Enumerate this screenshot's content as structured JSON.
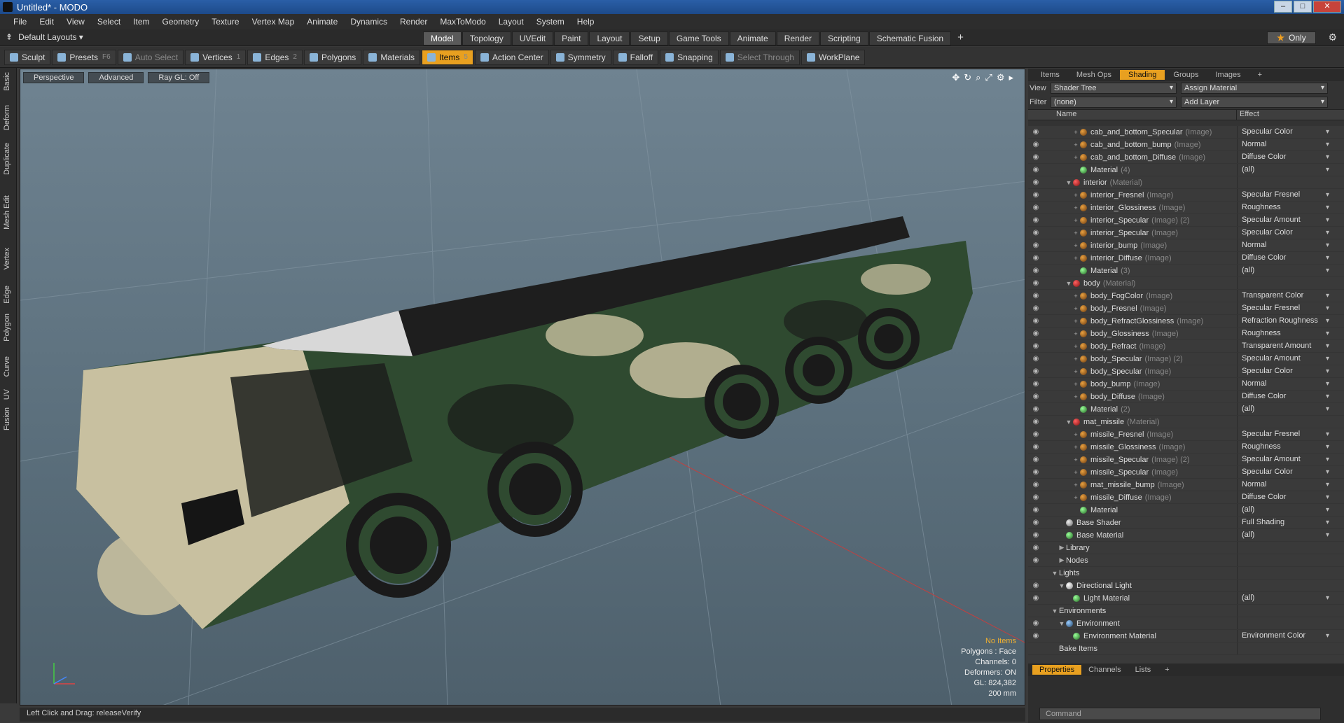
{
  "window": {
    "title": "Untitled* - MODO"
  },
  "menu": [
    "File",
    "Edit",
    "View",
    "Select",
    "Item",
    "Geometry",
    "Texture",
    "Vertex Map",
    "Animate",
    "Dynamics",
    "Render",
    "MaxToModo",
    "Layout",
    "System",
    "Help"
  ],
  "layout": {
    "name": "Default Layouts",
    "tabs": [
      "Model",
      "Topology",
      "UVEdit",
      "Paint",
      "Layout",
      "Setup",
      "Game Tools",
      "Animate",
      "Render",
      "Scripting",
      "Schematic Fusion"
    ],
    "active_tab": "Model",
    "only_label": "Only"
  },
  "toolbar": [
    {
      "label": "Sculpt",
      "key": ""
    },
    {
      "label": "Presets",
      "key": "F6"
    },
    {
      "label": "Auto Select",
      "key": "",
      "dim": true
    },
    {
      "label": "Vertices",
      "key": "1"
    },
    {
      "label": "Edges",
      "key": "2"
    },
    {
      "label": "Polygons",
      "key": ""
    },
    {
      "label": "Materials",
      "key": ""
    },
    {
      "label": "Items",
      "key": "5",
      "active": true
    },
    {
      "label": "Action Center",
      "key": ""
    },
    {
      "label": "Symmetry",
      "key": ""
    },
    {
      "label": "Falloff",
      "key": ""
    },
    {
      "label": "Snapping",
      "key": ""
    },
    {
      "label": "Select Through",
      "key": "",
      "dim": true
    },
    {
      "label": "WorkPlane",
      "key": ""
    }
  ],
  "leftbar": [
    "Basic",
    "Deform",
    "Duplicate",
    "Mesh Edit",
    "Vertex",
    "Edge",
    "Polygon",
    "Curve",
    "UV",
    "Fusion"
  ],
  "viewport": {
    "buttons": [
      "Perspective",
      "Advanced",
      "Ray GL: Off"
    ],
    "stats": {
      "no_items": "No Items",
      "polygons": "Polygons : Face",
      "channels": "Channels: 0",
      "deformers": "Deformers: ON",
      "gl": "GL: 824,382",
      "scale": "200 mm"
    }
  },
  "status": {
    "text": "Left Click and Drag:  releaseVerify"
  },
  "panel": {
    "tabs": [
      "Items",
      "Mesh Ops",
      "Shading",
      "Groups",
      "Images"
    ],
    "active_tab": "Shading",
    "view_label": "View",
    "view_value": "Shader Tree",
    "assign": "Assign Material",
    "filter_label": "Filter",
    "filter_value": "(none)",
    "add_layer": "Add Layer",
    "col_name": "Name",
    "col_effect": "Effect",
    "tree": [
      {
        "indent": 3,
        "tw": "+",
        "icon": "img",
        "name": "cab_and_bottom_Specular",
        "type": "(Image)",
        "effect": "Specular Color"
      },
      {
        "indent": 3,
        "tw": "+",
        "icon": "img",
        "name": "cab_and_bottom_bump",
        "type": "(Image)",
        "effect": "Normal"
      },
      {
        "indent": 3,
        "tw": "+",
        "icon": "img",
        "name": "cab_and_bottom_Diffuse",
        "type": "(Image)",
        "effect": "Diffuse Color"
      },
      {
        "indent": 3,
        "tw": "",
        "icon": "gr",
        "name": "Material",
        "type": "(4)",
        "effect": "(all)"
      },
      {
        "indent": 2,
        "tw": "▼",
        "icon": "matr",
        "name": "interior",
        "type": "(Material)",
        "effect": ""
      },
      {
        "indent": 3,
        "tw": "+",
        "icon": "img",
        "name": "interior_Fresnel",
        "type": "(Image)",
        "effect": "Specular Fresnel"
      },
      {
        "indent": 3,
        "tw": "+",
        "icon": "img",
        "name": "interior_Glossiness",
        "type": "(Image)",
        "effect": "Roughness"
      },
      {
        "indent": 3,
        "tw": "+",
        "icon": "img",
        "name": "interior_Specular",
        "type": "(Image) (2)",
        "effect": "Specular Amount"
      },
      {
        "indent": 3,
        "tw": "+",
        "icon": "img",
        "name": "interior_Specular",
        "type": "(Image)",
        "effect": "Specular Color"
      },
      {
        "indent": 3,
        "tw": "+",
        "icon": "img",
        "name": "interior_bump",
        "type": "(Image)",
        "effect": "Normal"
      },
      {
        "indent": 3,
        "tw": "+",
        "icon": "img",
        "name": "interior_Diffuse",
        "type": "(Image)",
        "effect": "Diffuse Color"
      },
      {
        "indent": 3,
        "tw": "",
        "icon": "gr",
        "name": "Material",
        "type": "(3)",
        "effect": "(all)"
      },
      {
        "indent": 2,
        "tw": "▼",
        "icon": "matr",
        "name": "body",
        "type": "(Material)",
        "effect": ""
      },
      {
        "indent": 3,
        "tw": "+",
        "icon": "img",
        "name": "body_FogColor",
        "type": "(Image)",
        "effect": "Transparent Color"
      },
      {
        "indent": 3,
        "tw": "+",
        "icon": "img",
        "name": "body_Fresnel",
        "type": "(Image)",
        "effect": "Specular Fresnel"
      },
      {
        "indent": 3,
        "tw": "+",
        "icon": "img",
        "name": "body_RefractGlossiness",
        "type": "(Image)",
        "effect": "Refraction Roughness"
      },
      {
        "indent": 3,
        "tw": "+",
        "icon": "img",
        "name": "body_Glossiness",
        "type": "(Image)",
        "effect": "Roughness"
      },
      {
        "indent": 3,
        "tw": "+",
        "icon": "img",
        "name": "body_Refract",
        "type": "(Image)",
        "effect": "Transparent Amount"
      },
      {
        "indent": 3,
        "tw": "+",
        "icon": "img",
        "name": "body_Specular",
        "type": "(Image) (2)",
        "effect": "Specular Amount"
      },
      {
        "indent": 3,
        "tw": "+",
        "icon": "img",
        "name": "body_Specular",
        "type": "(Image)",
        "effect": "Specular Color"
      },
      {
        "indent": 3,
        "tw": "+",
        "icon": "img",
        "name": "body_bump",
        "type": "(Image)",
        "effect": "Normal"
      },
      {
        "indent": 3,
        "tw": "+",
        "icon": "img",
        "name": "body_Diffuse",
        "type": "(Image)",
        "effect": "Diffuse Color"
      },
      {
        "indent": 3,
        "tw": "",
        "icon": "gr",
        "name": "Material",
        "type": "(2)",
        "effect": "(all)"
      },
      {
        "indent": 2,
        "tw": "▼",
        "icon": "matr",
        "name": "mat_missile",
        "type": "(Material)",
        "effect": ""
      },
      {
        "indent": 3,
        "tw": "+",
        "icon": "img",
        "name": "missile_Fresnel",
        "type": "(Image)",
        "effect": "Specular Fresnel"
      },
      {
        "indent": 3,
        "tw": "+",
        "icon": "img",
        "name": "missile_Glossiness",
        "type": "(Image)",
        "effect": "Roughness"
      },
      {
        "indent": 3,
        "tw": "+",
        "icon": "img",
        "name": "missile_Specular",
        "type": "(Image) (2)",
        "effect": "Specular Amount"
      },
      {
        "indent": 3,
        "tw": "+",
        "icon": "img",
        "name": "missile_Specular",
        "type": "(Image)",
        "effect": "Specular Color"
      },
      {
        "indent": 3,
        "tw": "+",
        "icon": "img",
        "name": "mat_missile_bump",
        "type": "(Image)",
        "effect": "Normal"
      },
      {
        "indent": 3,
        "tw": "+",
        "icon": "img",
        "name": "missile_Diffuse",
        "type": "(Image)",
        "effect": "Diffuse Color"
      },
      {
        "indent": 3,
        "tw": "",
        "icon": "gr",
        "name": "Material",
        "type": "",
        "effect": "(all)"
      },
      {
        "indent": 1,
        "tw": "",
        "icon": "mat",
        "name": "Base Shader",
        "type": "",
        "effect": "Full Shading"
      },
      {
        "indent": 1,
        "tw": "",
        "icon": "gr",
        "name": "Base Material",
        "type": "",
        "effect": "(all)"
      },
      {
        "indent": 1,
        "tw": "▶",
        "icon": "",
        "name": "Library",
        "type": "",
        "effect": ""
      },
      {
        "indent": 1,
        "tw": "▶",
        "icon": "",
        "name": "Nodes",
        "type": "",
        "effect": ""
      },
      {
        "indent": 0,
        "tw": "▼",
        "icon": "",
        "name": "Lights",
        "type": "",
        "effect": ""
      },
      {
        "indent": 1,
        "tw": "▼",
        "icon": "light",
        "name": "Directional Light",
        "type": "",
        "effect": ""
      },
      {
        "indent": 2,
        "tw": "",
        "icon": "gr",
        "name": "Light Material",
        "type": "",
        "effect": "(all)"
      },
      {
        "indent": 0,
        "tw": "▼",
        "icon": "",
        "name": "Environments",
        "type": "",
        "effect": ""
      },
      {
        "indent": 1,
        "tw": "▼",
        "icon": "env",
        "name": "Environment",
        "type": "",
        "effect": ""
      },
      {
        "indent": 2,
        "tw": "",
        "icon": "gr",
        "name": "Environment Material",
        "type": "",
        "effect": "Environment Color"
      },
      {
        "indent": 0,
        "tw": "",
        "icon": "",
        "name": "Bake Items",
        "type": "",
        "effect": ""
      }
    ],
    "bottom_tabs": [
      "Properties",
      "Channels",
      "Lists"
    ],
    "bottom_active": "Properties",
    "command_placeholder": "Command"
  },
  "colors": {
    "accent": "#e8a020",
    "camo_green": "#2f4a30",
    "camo_tan": "#c8c0a0",
    "missile": "#1e1e1e"
  }
}
